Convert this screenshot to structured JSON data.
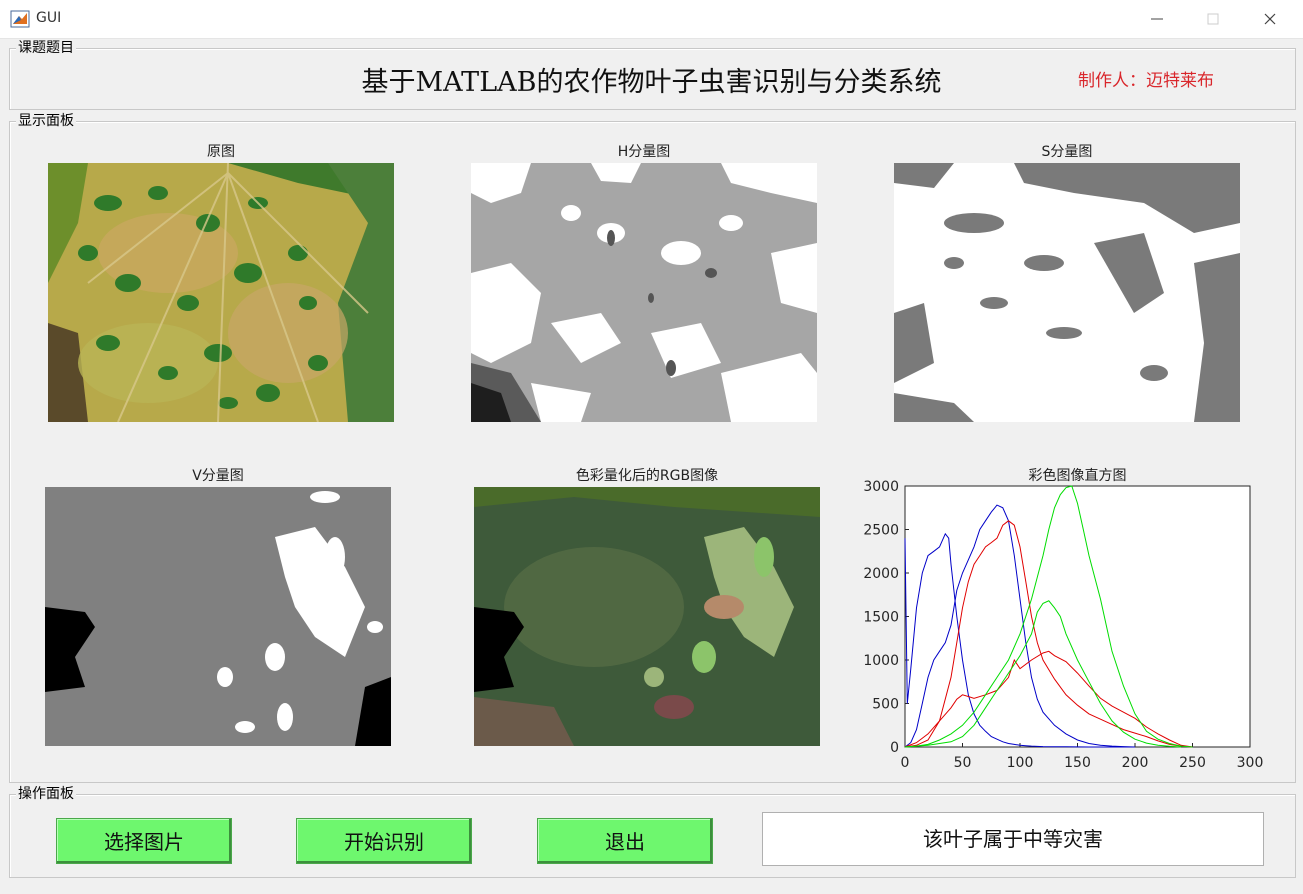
{
  "window": {
    "title": "GUI",
    "app_icon": "matlab-icon",
    "controls": [
      "minimize-icon",
      "maximize-icon",
      "close-icon"
    ]
  },
  "topic_panel": {
    "label": "课题题目",
    "title": "基于MATLAB的农作物叶子虫害识别与分类系统",
    "author": "制作人：迈特莱布",
    "author_color": "#d9262b"
  },
  "display_panel": {
    "label": "显示面板",
    "axes": [
      {
        "title": "原图"
      },
      {
        "title": "H分量图"
      },
      {
        "title": "S分量图"
      },
      {
        "title": "V分量图"
      },
      {
        "title": "色彩量化后的RGB图像"
      },
      {
        "title": "彩色图像直方图"
      }
    ]
  },
  "chart_data": {
    "type": "line",
    "title": "彩色图像直方图",
    "xlabel": "",
    "ylabel": "",
    "xlim": [
      0,
      300
    ],
    "ylim": [
      0,
      3000
    ],
    "xticks": [
      "0",
      "50",
      "100",
      "150",
      "200",
      "250",
      "300"
    ],
    "yticks": [
      "0",
      "500",
      "1000",
      "1500",
      "2000",
      "2500",
      "3000"
    ],
    "grid": false,
    "series": [
      {
        "color": "#0000c8",
        "x": [
          0,
          2,
          5,
          10,
          15,
          20,
          25,
          30,
          35,
          38,
          40,
          45,
          50,
          55,
          60,
          65,
          70,
          75,
          80,
          85,
          90,
          95,
          100,
          105,
          110,
          120,
          130,
          140,
          150,
          160,
          170,
          180,
          190,
          200
        ],
        "y": [
          2400,
          500,
          900,
          1600,
          2000,
          2200,
          2250,
          2300,
          2450,
          2400,
          2100,
          1500,
          1000,
          600,
          380,
          250,
          180,
          120,
          90,
          60,
          40,
          30,
          20,
          15,
          10,
          5,
          3,
          2,
          1,
          0,
          0,
          0,
          0,
          0
        ]
      },
      {
        "color": "#0000c8",
        "x": [
          0,
          5,
          10,
          15,
          20,
          25,
          30,
          35,
          40,
          45,
          50,
          55,
          60,
          65,
          70,
          75,
          80,
          85,
          90,
          95,
          100,
          105,
          110,
          115,
          120,
          130,
          140,
          150,
          160,
          170,
          180,
          190,
          200
        ],
        "y": [
          0,
          50,
          200,
          500,
          800,
          1000,
          1100,
          1200,
          1400,
          1800,
          2000,
          2150,
          2300,
          2500,
          2600,
          2700,
          2780,
          2750,
          2600,
          2200,
          1700,
          1200,
          800,
          550,
          400,
          250,
          150,
          80,
          40,
          20,
          10,
          5,
          0
        ]
      },
      {
        "color": "#e00000",
        "x": [
          0,
          10,
          20,
          30,
          40,
          45,
          50,
          55,
          60,
          65,
          70,
          75,
          80,
          85,
          90,
          95,
          100,
          105,
          110,
          115,
          120,
          130,
          140,
          150,
          160,
          170,
          180,
          190,
          200,
          210,
          220,
          230,
          240,
          250
        ],
        "y": [
          0,
          20,
          80,
          300,
          800,
          1200,
          1600,
          1900,
          2100,
          2200,
          2300,
          2350,
          2400,
          2550,
          2600,
          2550,
          2300,
          1900,
          1500,
          1200,
          1000,
          780,
          600,
          480,
          380,
          320,
          260,
          200,
          160,
          120,
          70,
          30,
          10,
          0
        ]
      },
      {
        "color": "#e00000",
        "x": [
          0,
          10,
          20,
          30,
          40,
          45,
          50,
          55,
          60,
          70,
          80,
          90,
          95,
          100,
          110,
          120,
          125,
          130,
          140,
          150,
          160,
          170,
          180,
          190,
          200,
          210,
          215,
          220,
          230,
          240,
          250
        ],
        "y": [
          0,
          50,
          150,
          300,
          450,
          550,
          600,
          580,
          560,
          600,
          650,
          800,
          1000,
          900,
          1000,
          1080,
          1100,
          1050,
          980,
          850,
          700,
          560,
          470,
          400,
          330,
          230,
          190,
          150,
          80,
          20,
          0
        ]
      },
      {
        "color": "#00dd00",
        "x": [
          0,
          10,
          20,
          30,
          40,
          50,
          60,
          70,
          80,
          90,
          100,
          110,
          120,
          125,
          130,
          135,
          140,
          145,
          150,
          155,
          160,
          170,
          180,
          190,
          200,
          210,
          220,
          230,
          240,
          250
        ],
        "y": [
          0,
          10,
          30,
          80,
          150,
          250,
          400,
          600,
          800,
          1000,
          1300,
          1700,
          2200,
          2500,
          2750,
          2900,
          2980,
          3000,
          2800,
          2500,
          2200,
          1700,
          1100,
          700,
          380,
          180,
          90,
          40,
          10,
          0
        ]
      },
      {
        "color": "#00dd00",
        "x": [
          0,
          20,
          40,
          50,
          60,
          70,
          80,
          90,
          100,
          110,
          115,
          120,
          125,
          130,
          135,
          140,
          150,
          160,
          170,
          180,
          190,
          200,
          210,
          220,
          230,
          240
        ],
        "y": [
          0,
          20,
          60,
          120,
          250,
          450,
          650,
          850,
          1050,
          1300,
          1550,
          1650,
          1680,
          1600,
          1500,
          1300,
          1000,
          750,
          500,
          300,
          170,
          90,
          45,
          20,
          8,
          0
        ]
      }
    ]
  },
  "operation_panel": {
    "label": "操作面板",
    "buttons": {
      "select_image": "选择图片",
      "start_recognition": "开始识别",
      "exit": "退出"
    },
    "button_color": "#6ef76e",
    "result": "该叶子属于中等灾害"
  }
}
